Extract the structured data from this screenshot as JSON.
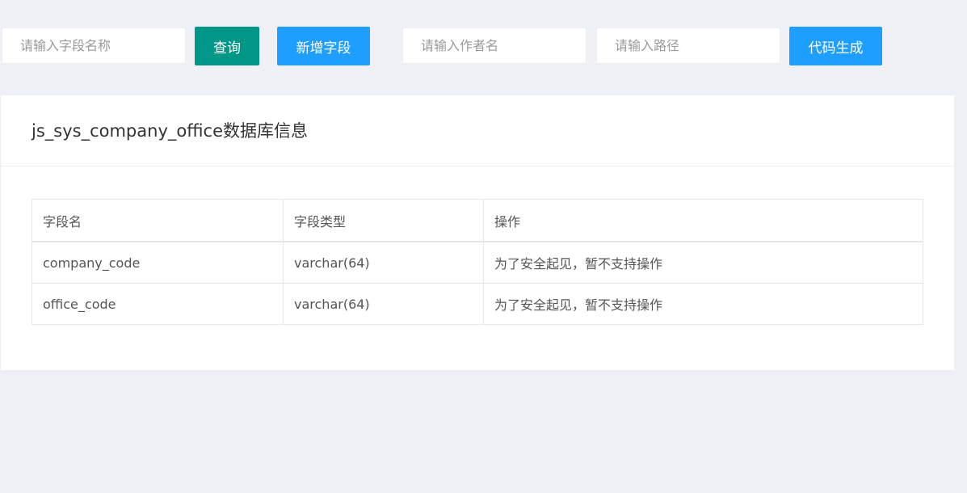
{
  "toolbar": {
    "field_search_placeholder": "请输入字段名称",
    "query_label": "查询",
    "add_field_label": "新增字段",
    "author_placeholder": "请输入作者名",
    "path_placeholder": "请输入路径",
    "generate_label": "代码生成"
  },
  "card": {
    "title": "js_sys_company_office数据库信息"
  },
  "table": {
    "columns": [
      "字段名",
      "字段类型",
      "操作"
    ],
    "rows": [
      {
        "name": "company_code",
        "type": "varchar(64)",
        "action": "为了安全起见，暂不支持操作"
      },
      {
        "name": "office_code",
        "type": "varchar(64)",
        "action": "为了安全起见，暂不支持操作"
      }
    ]
  },
  "colors": {
    "page_bg": "#f0f1f7",
    "query_button": "#009688",
    "primary_button": "#1e9fff"
  }
}
